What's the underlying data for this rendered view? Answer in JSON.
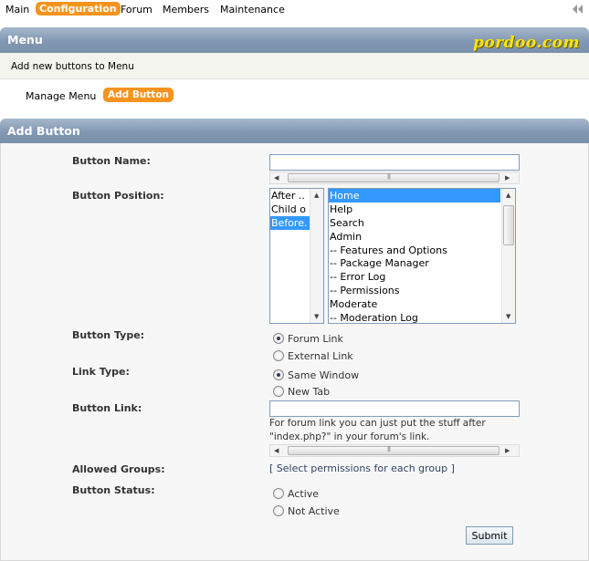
{
  "topnav": {
    "items": [
      "Main",
      "Configuration",
      "Forum",
      "Members",
      "Maintenance"
    ],
    "active": "Configuration"
  },
  "menu_header": {
    "title": "Menu",
    "logo_text": "pordoo.com"
  },
  "description": "Add new buttons to Menu",
  "subtabs": {
    "manage_label": "Manage Menu",
    "add_label": "Add Button"
  },
  "form_header": {
    "title": "Add Button"
  },
  "form": {
    "button_name_label": "Button Name:",
    "button_name_value": "",
    "button_position_label": "Button Position:",
    "position_options": [
      "After ..",
      "Child o",
      "Before."
    ],
    "position_selected": 2,
    "target_options": [
      "Home",
      "Help",
      "Search",
      "Admin",
      "-- Features and Options",
      "-- Package Manager",
      "-- Error Log",
      "-- Permissions",
      "Moderate",
      "-- Moderation Log"
    ],
    "target_selected": 0,
    "button_type_label": "Button Type:",
    "button_type_options": [
      "Forum Link",
      "External Link"
    ],
    "button_type_selected": 0,
    "link_type_label": "Link Type:",
    "link_type_options": [
      "Same Window",
      "New Tab"
    ],
    "link_type_selected": 0,
    "button_link_label": "Button Link:",
    "button_link_value": "",
    "button_link_hint": "For forum link you can just put the stuff after \"index.php?\" in your forum's link.",
    "allowed_groups_label": "Allowed Groups:",
    "allowed_groups_link": "[ Select permissions for each group ]",
    "button_status_label": "Button Status:",
    "status_options": [
      "Active",
      "Not Active"
    ],
    "status_selected": -1,
    "submit_label": "Submit"
  },
  "colors": {
    "accent": "#f7941d",
    "header": "#8197b2",
    "selection": "#3399ff",
    "logo": "#ffe600"
  }
}
